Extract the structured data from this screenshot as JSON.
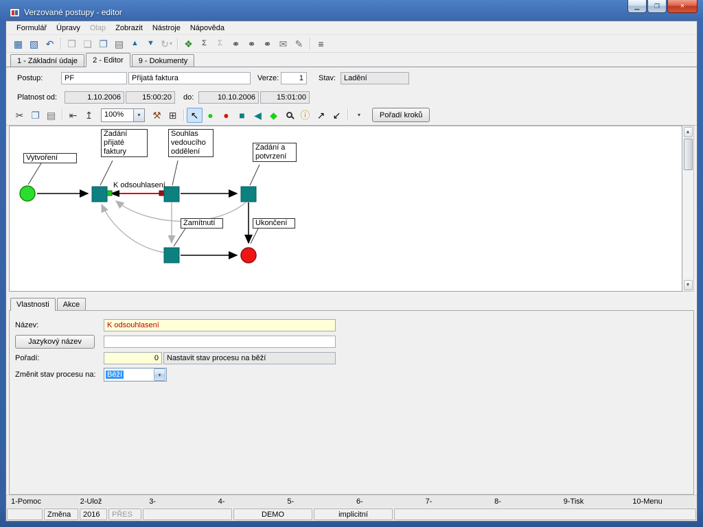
{
  "window": {
    "title": "Verzované postupy - editor",
    "controls": {
      "minimize": "▁",
      "maximize": "❐",
      "close": "×"
    }
  },
  "menu": {
    "items": [
      {
        "label": "Formulář"
      },
      {
        "label": "Úpravy"
      },
      {
        "label": "Olap"
      },
      {
        "label": "Zobrazit"
      },
      {
        "label": "Nástroje"
      },
      {
        "label": "Nápověda"
      }
    ]
  },
  "icons": {
    "save": "▦",
    "save_as": "▧",
    "undo": "↶",
    "open": "❒",
    "new_doc": "❏",
    "copy": "❐",
    "paste": "▤",
    "up": "▲",
    "down": "▼",
    "refresh": "↻",
    "caret": "▾",
    "tree": "❖",
    "sum": "Σ",
    "find": "⚭",
    "find_next": "⚭",
    "find_add": "⚭",
    "mail": "✉",
    "edit": "✎",
    "menu": "≡",
    "cut": "✂",
    "align_left": "⇤",
    "align_top": "↥",
    "tools": "⚒",
    "grid": "⊞",
    "pointer": "↖",
    "circle": "●",
    "square": "■",
    "triangle": "◀",
    "diamond": "◆",
    "info": "ⓘ",
    "arrow_ne": "↗",
    "arrow_sw": "↙",
    "scroll_up": "▲",
    "scroll_down": "▼"
  },
  "tabs": [
    {
      "label": "1 - Základní údaje"
    },
    {
      "label": "2 - Editor"
    },
    {
      "label": "9 - Dokumenty"
    }
  ],
  "form": {
    "postup_label": "Postup:",
    "postup_code": "PF",
    "postup_name": "Přijatá faktura",
    "verze_label": "Verze:",
    "verze_value": "1",
    "stav_label": "Stav:",
    "stav_value": "Ladění",
    "platnost_od_label": "Platnost od:",
    "od_date": "1.10.2006",
    "od_time": "15:00:20",
    "do_label": "do:",
    "do_date": "10.10.2006",
    "do_time": "15:01:00"
  },
  "canvas_toolbar": {
    "zoom": "100%",
    "order_button": "Pořadí kroků"
  },
  "diagram": {
    "labels": {
      "vytvoreni": "Vytvoření",
      "zadani_prijate": "Zadání přijaté faktury",
      "souhlas": "Souhlas vedoucího oddělení",
      "zadani_potvrzeni": "Zadání a potvrzení",
      "k_odsouhlaseni": "K odsouhlasení",
      "zamitnuti": "Zamítnutí",
      "ukonceni": "Ukončení"
    }
  },
  "properties": {
    "tab_vlastnosti": "Vlastnosti",
    "tab_akce": "Akce",
    "nazev_label": "Název:",
    "nazev_value": "K odsouhlasení",
    "jazykovy_nazev_button": "Jazykový název",
    "jazykovy_value": "",
    "poradi_label": "Pořadí:",
    "poradi_value": "0",
    "nastavit_text": "Nastavit stav procesu na běží",
    "zmenit_label": "Změnit stav procesu na:",
    "zmenit_value": "Běží"
  },
  "function_keys": [
    "1-Pomoc",
    "2-Ulož",
    "3-",
    "4-",
    "5-",
    "6-",
    "7-",
    "8-",
    "9-Tisk",
    "10-Menu"
  ],
  "statusbar": {
    "mode": "Změna",
    "year": "2016",
    "overwrite": "PŘES",
    "db": "DEMO",
    "profile": "implicitní"
  }
}
